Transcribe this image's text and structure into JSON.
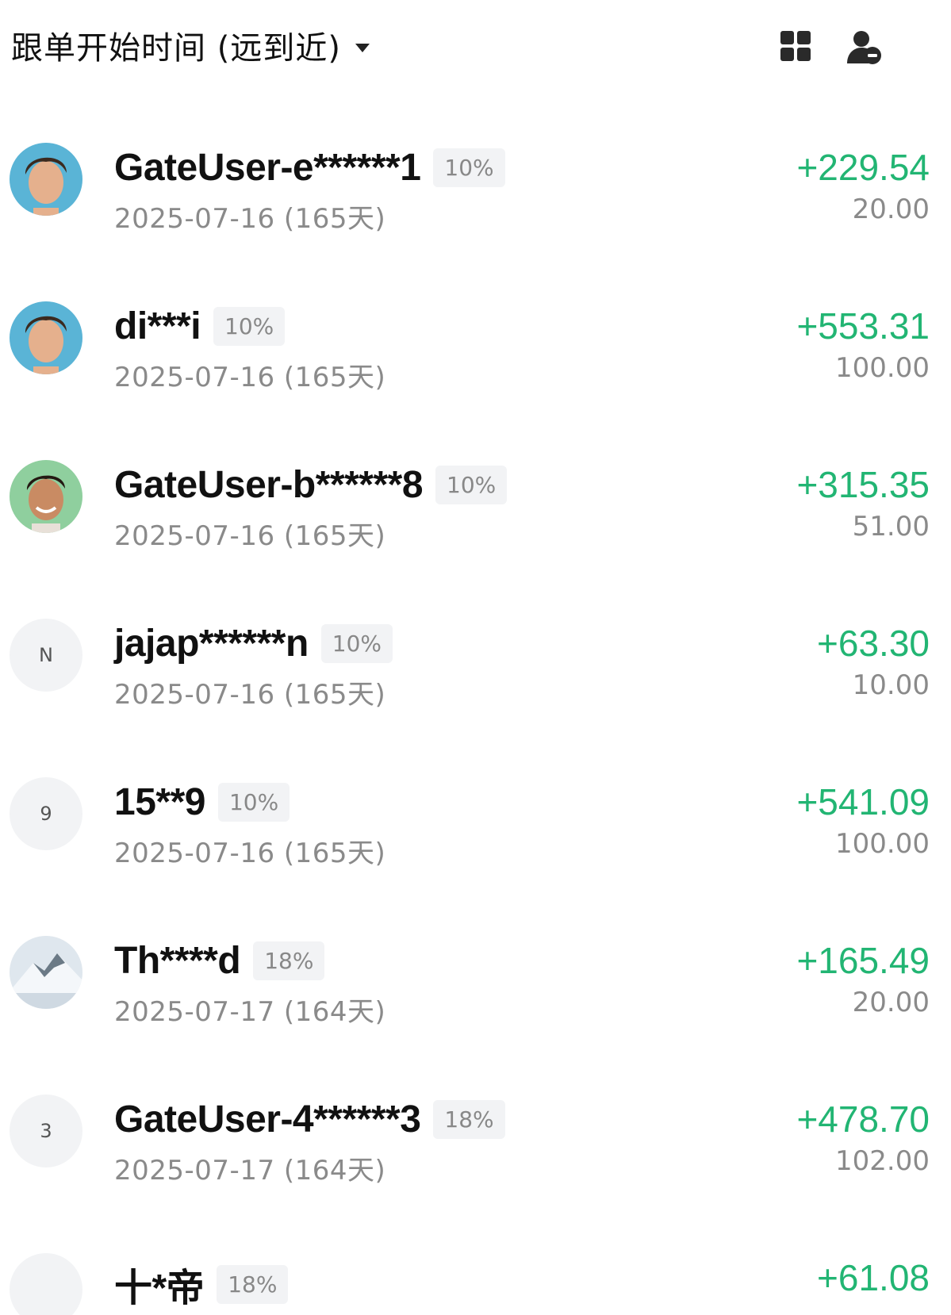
{
  "header": {
    "sort_label": "跟单开始时间 (远到近)",
    "grid_icon": "grid-view-icon",
    "user_manage_icon": "user-remove-icon"
  },
  "colors": {
    "profit": "#22b573",
    "secondary_text": "#8a8a8a",
    "badge_bg": "#f2f3f5"
  },
  "followers": [
    {
      "name": "GateUser-e******1",
      "ratio": "10%",
      "date": "2025-07-16 (165天)",
      "pnl": "+229.54",
      "amount": "20.00",
      "avatar": "photo-man-curly-hair"
    },
    {
      "name": "di***i",
      "ratio": "10%",
      "date": "2025-07-16 (165天)",
      "pnl": "+553.31",
      "amount": "100.00",
      "avatar": "photo-man-curly-hair"
    },
    {
      "name": "GateUser-b******8",
      "ratio": "10%",
      "date": "2025-07-16 (165天)",
      "pnl": "+315.35",
      "amount": "51.00",
      "avatar": "photo-man-smiling"
    },
    {
      "name": "jajap******n",
      "ratio": "10%",
      "date": "2025-07-16 (165天)",
      "pnl": "+63.30",
      "amount": "10.00",
      "avatar_letter": "N"
    },
    {
      "name": "15**9",
      "ratio": "10%",
      "date": "2025-07-16 (165天)",
      "pnl": "+541.09",
      "amount": "100.00",
      "avatar_letter": "9"
    },
    {
      "name": "Th****d",
      "ratio": "18%",
      "date": "2025-07-17 (164天)",
      "pnl": "+165.49",
      "amount": "20.00",
      "avatar": "photo-snowy-mountain"
    },
    {
      "name": "GateUser-4******3",
      "ratio": "18%",
      "date": "2025-07-17 (164天)",
      "pnl": "+478.70",
      "amount": "102.00",
      "avatar_letter": "3"
    },
    {
      "name": "十*帝",
      "ratio": "18%",
      "date": "",
      "pnl": "+61.08",
      "amount": "",
      "avatar_letter": ""
    }
  ]
}
